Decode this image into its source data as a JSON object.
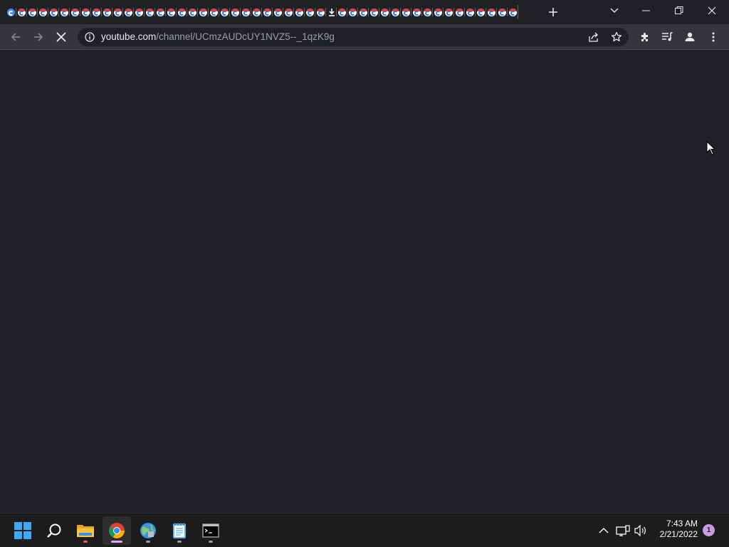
{
  "browser": {
    "tab_count": 48,
    "download_tab_index": 30,
    "address_bar": {
      "url_host": "youtube.com",
      "url_path": "/channel/UCmzAUDcUY1NVZ5--_1qzK9g"
    },
    "loading": true
  },
  "taskbar": {
    "apps": [
      {
        "name": "start-button",
        "icon": "windows-logo"
      },
      {
        "name": "search-button",
        "icon": "search-icon"
      },
      {
        "name": "file-explorer",
        "icon": "folder-icon",
        "running": true
      },
      {
        "name": "chrome",
        "icon": "chrome-icon",
        "active": true
      },
      {
        "name": "network-app",
        "icon": "globe-icon",
        "running": true
      },
      {
        "name": "notepad",
        "icon": "notepad-icon",
        "running": true
      },
      {
        "name": "terminal",
        "icon": "terminal-icon",
        "running": true
      }
    ],
    "clock": {
      "time": "7:43 AM",
      "date": "2/21/2022"
    },
    "notification_count": "1"
  },
  "colors": {
    "page_bg": "#202124",
    "toolbar_bg": "#35363a",
    "taskbar_bg": "#1c1c1c",
    "accent": "#d7a8f0"
  }
}
